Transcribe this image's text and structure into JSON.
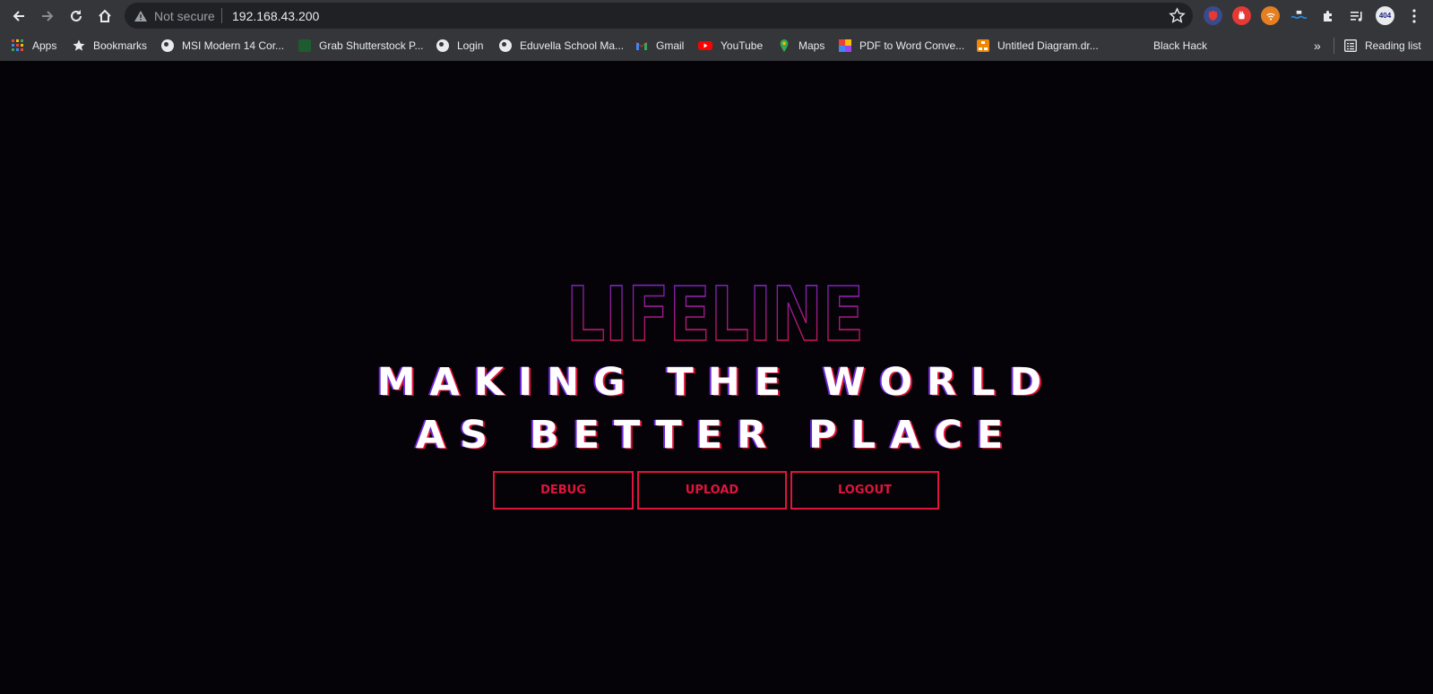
{
  "browser": {
    "security_label": "Not secure",
    "url": "192.168.43.200",
    "extensions": [
      {
        "icon": "shield-extension-icon",
        "color": "#c0392b"
      },
      {
        "icon": "adblock-hand-icon",
        "color": "#e53935"
      },
      {
        "icon": "wifi-extension-icon",
        "color": "#e67e22"
      },
      {
        "icon": "ocean-extension-icon",
        "color": "#1e88e5"
      },
      {
        "icon": "puzzle-icon",
        "color": "#e8eaed"
      },
      {
        "icon": "media-queue-icon",
        "color": "#e8eaed"
      },
      {
        "icon": "404-extension-icon",
        "label": "404",
        "color": "#2b3a67"
      },
      {
        "icon": "menu-dots-icon",
        "color": "#e8eaed"
      }
    ]
  },
  "bookmarks": {
    "items": [
      {
        "label": "Apps",
        "icon": "apps-grid-icon"
      },
      {
        "label": "Bookmarks",
        "icon": "star-icon"
      },
      {
        "label": "MSI Modern 14 Cor...",
        "icon": "globe-icon"
      },
      {
        "label": "Grab Shutterstock P...",
        "icon": "shutterstock-icon"
      },
      {
        "label": "Login",
        "icon": "globe-icon"
      },
      {
        "label": "Eduvella School Ma...",
        "icon": "globe-icon"
      },
      {
        "label": "Gmail",
        "icon": "gmail-icon"
      },
      {
        "label": "YouTube",
        "icon": "youtube-icon"
      },
      {
        "label": "Maps",
        "icon": "maps-pin-icon"
      },
      {
        "label": "PDF to Word Conve...",
        "icon": "pdf-converter-icon"
      },
      {
        "label": "Untitled Diagram.dr...",
        "icon": "drawio-icon"
      },
      {
        "label": "Black Hack",
        "icon": "blank-icon"
      }
    ],
    "overflow_label": "»",
    "reading_list_label": "Reading list"
  },
  "hero": {
    "logo_text": "LIFELINE",
    "headline_line1": "MAKING THE WORLD",
    "headline_line2": "AS BETTER PLACE"
  },
  "actions": {
    "debug_label": "DEBUG",
    "upload_label": "UPLOAD",
    "logout_label": "LOGOUT"
  },
  "colors": {
    "accent_red": "#e0143c",
    "accent_purple": "#6a26d8",
    "page_background": "#050307"
  }
}
